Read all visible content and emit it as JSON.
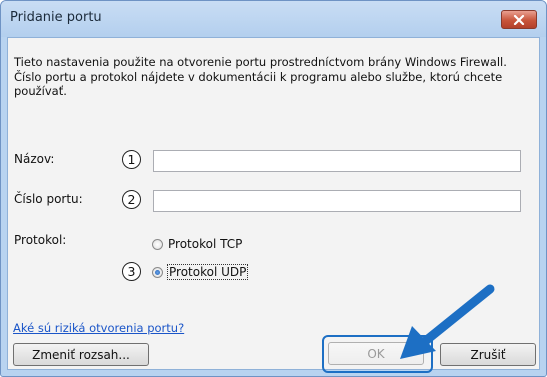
{
  "window": {
    "title": "Pridanie portu"
  },
  "description": "Tieto nastavenia použite na otvorenie portu prostredníctvom brány Windows Firewall. Číslo portu a protokol nájdete v dokumentácii k programu alebo službe, ktorú chcete používať.",
  "fields": {
    "name": {
      "label": "Názov:",
      "marker": "1",
      "value": ""
    },
    "port": {
      "label": "Číslo portu:",
      "marker": "2",
      "value": ""
    }
  },
  "protocol": {
    "label": "Protokol:",
    "options": [
      {
        "label": "Protokol TCP",
        "selected": false
      },
      {
        "label": "Protokol UDP",
        "selected": true
      }
    ],
    "marker": "3"
  },
  "link": "Aké sú riziká otvorenia portu?",
  "buttons": {
    "change_scope": "Zmeniť rozsah...",
    "ok": "OK",
    "cancel": "Zrušiť"
  },
  "colors": {
    "arrow": "#1d6fc4",
    "link": "#1a55c8",
    "close": "#c8553b"
  },
  "icons": {
    "close": "close-icon",
    "arrow": "arrow-icon"
  }
}
